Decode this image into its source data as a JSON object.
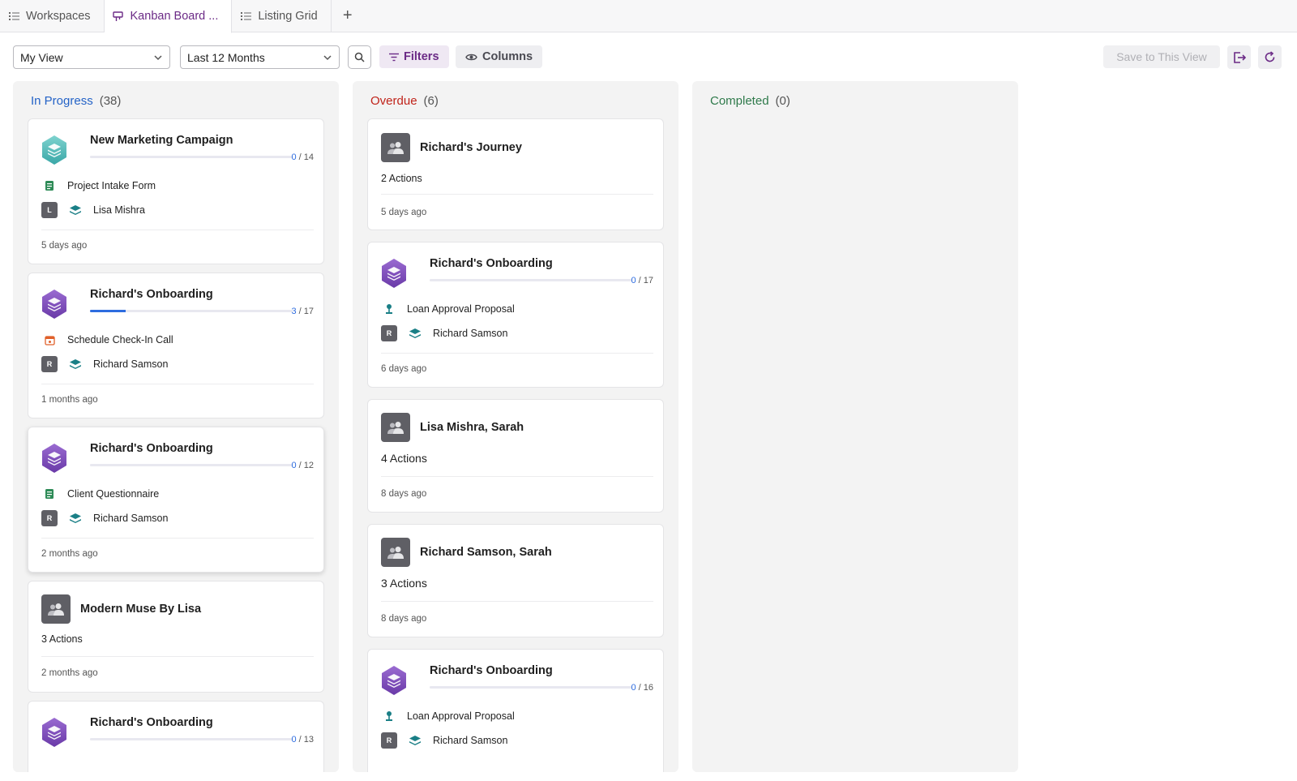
{
  "tabs": [
    {
      "label": "Workspaces",
      "icon": "list-icon",
      "active": false
    },
    {
      "label": "Kanban Board ...",
      "icon": "kanban-icon",
      "active": true
    },
    {
      "label": "Listing Grid",
      "icon": "list-icon",
      "active": false
    }
  ],
  "toolbar": {
    "view_select": "My View",
    "range_select": "Last 12 Months",
    "filters_label": "Filters",
    "columns_label": "Columns",
    "save_label": "Save to This View"
  },
  "colors": {
    "in_progress": "#2463c7",
    "overdue": "#c0231a",
    "completed": "#2f7a4b",
    "accent": "#6b2a86",
    "progress": "#2d6cdf"
  },
  "columns": [
    {
      "title": "In Progress",
      "count": "(38)",
      "cards": [
        {
          "type": "process",
          "title": "New Marketing Campaign",
          "icon": "teal-layers-hex-icon",
          "progress_done": "0",
          "progress_total": "/ 14",
          "progress_fraction": 0,
          "task": "Project Intake Form",
          "task_icon": "form-icon",
          "avatar": "L",
          "assignee": "Lisa Mishra",
          "ago": "5 days ago"
        },
        {
          "type": "process",
          "title": "Richard's Onboarding",
          "icon": "purple-layers-hex-icon",
          "progress_done": "3",
          "progress_total": "/ 17",
          "progress_fraction": 0.176,
          "task": "Schedule Check-In Call",
          "task_icon": "calendar-icon",
          "avatar": "R",
          "assignee": "Richard Samson",
          "ago": "1 months ago"
        },
        {
          "type": "process",
          "title": "Richard's Onboarding",
          "icon": "purple-layers-hex-icon",
          "progress_done": "0",
          "progress_total": "/ 12",
          "progress_fraction": 0,
          "task": "Client Questionnaire",
          "task_icon": "form-icon",
          "avatar": "R",
          "assignee": "Richard Samson",
          "ago": "2 months ago"
        },
        {
          "type": "group",
          "title": "Modern Muse By Lisa",
          "actions": "3 Actions",
          "ago": "2 months ago"
        },
        {
          "type": "process",
          "title": "Richard's Onboarding",
          "icon": "purple-layers-hex-icon",
          "progress_done": "0",
          "progress_total": "/ 13",
          "progress_fraction": 0
        }
      ]
    },
    {
      "title": "Overdue",
      "count": "(6)",
      "cards": [
        {
          "type": "group",
          "title": "Richard's Journey",
          "actions": "2 Actions",
          "ago": "5 days ago"
        },
        {
          "type": "process",
          "title": "Richard's Onboarding",
          "icon": "purple-layers-hex-icon",
          "progress_done": "0",
          "progress_total": "/ 17",
          "progress_fraction": 0,
          "task": "Loan Approval Proposal",
          "task_icon": "person-icon",
          "avatar": "R",
          "assignee": "Richard Samson",
          "ago": "6 days ago"
        },
        {
          "type": "group",
          "title": "Lisa Mishra, Sarah",
          "actions": "4 Actions",
          "ago": "8 days ago"
        },
        {
          "type": "group",
          "title": "Richard Samson, Sarah",
          "actions": "3 Actions",
          "ago": "8 days ago"
        },
        {
          "type": "process",
          "title": "Richard's Onboarding",
          "icon": "purple-layers-hex-icon",
          "progress_done": "0",
          "progress_total": "/ 16",
          "progress_fraction": 0,
          "task": "Loan Approval Proposal",
          "task_icon": "person-icon",
          "avatar": "R",
          "assignee": "Richard Samson"
        }
      ]
    },
    {
      "title": "Completed",
      "count": "(0)",
      "cards": []
    }
  ]
}
